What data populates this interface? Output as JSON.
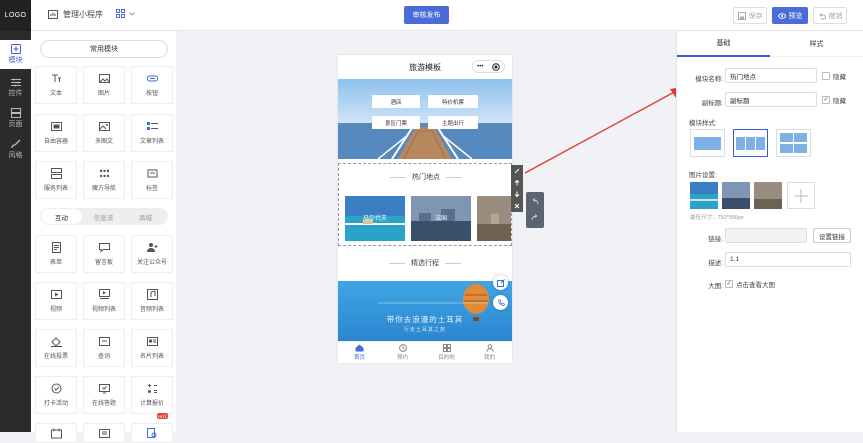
{
  "topbar": {
    "logo": "LOGO",
    "manage_label": "管理小程序",
    "audit_label": "审核发布",
    "save_label": "保存",
    "preview_label": "预览",
    "undo_label": "撤销"
  },
  "leftnav": [
    {
      "label": "模块",
      "icon": "plus-square-icon",
      "active": true
    },
    {
      "label": "控件",
      "icon": "sliders-icon",
      "active": false
    },
    {
      "label": "页面",
      "icon": "pages-icon",
      "active": false
    },
    {
      "label": "风格",
      "icon": "brush-icon",
      "active": false
    }
  ],
  "panel": {
    "common_title": "常用模块",
    "common_items": [
      "文本",
      "图片",
      "按钮",
      "自由容器",
      "多图文",
      "文章列表",
      "服务列表",
      "魔方导航",
      "标签"
    ],
    "segments": [
      "互动",
      "信息流",
      "商城"
    ],
    "interact_items": [
      "表单",
      "留言板",
      "关注公众号",
      "视频",
      "视频列表",
      "音频列表",
      "在线投票",
      "查词",
      "名片列表",
      "打卡活动",
      "在线答题",
      "计算报价",
      "",
      "",
      ""
    ],
    "hot_badge": "HOT"
  },
  "phone": {
    "title": "旅游模板",
    "capsule_dots": "•••",
    "banner_buttons": [
      "酒店",
      "特价机票",
      "景区门票",
      "主题出行"
    ],
    "hot_section_title": "热门地点",
    "hot_places": [
      "马尔代夫",
      "法国",
      ""
    ],
    "trip_section_title": "精选行程",
    "trip_banner_text": "带你去浪漫的土耳其",
    "trip_banner_sub": "行走土耳其之旅",
    "tabs": [
      "首页",
      "预约",
      "目的地",
      "我的"
    ]
  },
  "rpanel": {
    "tabs": [
      "基础",
      "样式"
    ],
    "module_name_label": "模块名称:",
    "module_name_value": "热门地点",
    "hide_label": "隐藏",
    "subtitle_label": "副标题:",
    "subtitle_value": "副标题",
    "style_label": "模块样式:",
    "image_setting_label": "图片设置:",
    "image_hint": "最佳尺寸：750*556px",
    "link_label": "链接:",
    "link_button": "设置链接",
    "desc_label": "描述:",
    "desc_value": "1.1",
    "bigimg_label": "大图:",
    "bigimg_check": "点击查看大图"
  },
  "colors": {
    "accent": "#4a6bd8",
    "nav_bg": "#2b2b2b",
    "arrow": "#e03a2f"
  }
}
